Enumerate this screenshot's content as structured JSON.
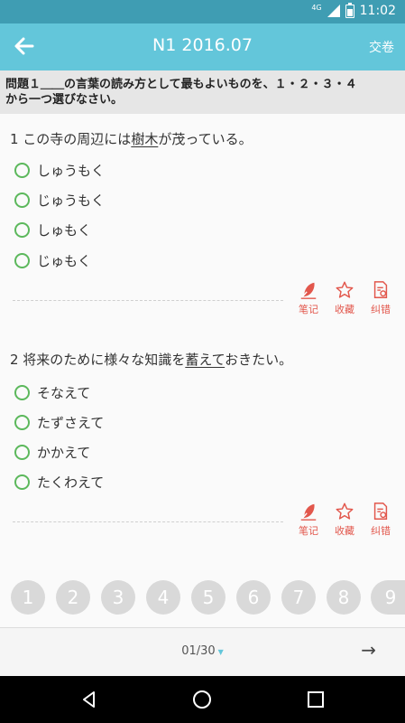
{
  "status_bar": {
    "network": "4G",
    "time": "11:02"
  },
  "app_bar": {
    "title": "N1 2016.07",
    "submit_label": "交卷"
  },
  "section": {
    "title_line1": "問題１＿＿の言葉の読み方として最もよいものを、１・２・３・４",
    "title_line2": "から一つ選びなさい。"
  },
  "questions": [
    {
      "prefix": "1  この寺の周辺には",
      "underlined": "樹木",
      "suffix": "が茂っている。",
      "options": [
        "しゅうもく",
        "じゅうもく",
        "しゅもく",
        "じゅもく"
      ]
    },
    {
      "prefix": "2  将来のために様々な知識を",
      "underlined": "蓄えて",
      "suffix": "おきたい。",
      "options": [
        "そなえて",
        "たずさえて",
        "かかえて",
        "たくわえて"
      ]
    }
  ],
  "tools": {
    "note": "笔记",
    "favorite": "收藏",
    "report": "纠错"
  },
  "pager": [
    "1",
    "2",
    "3",
    "4",
    "5",
    "6",
    "7",
    "8",
    "9"
  ],
  "bottom": {
    "counter": "01/30",
    "next_symbol": "→"
  },
  "colors": {
    "app_bar": "#63c6da",
    "status_bar": "#3f9db3",
    "accent": "#e2574c",
    "radio": "#5cb85c"
  }
}
